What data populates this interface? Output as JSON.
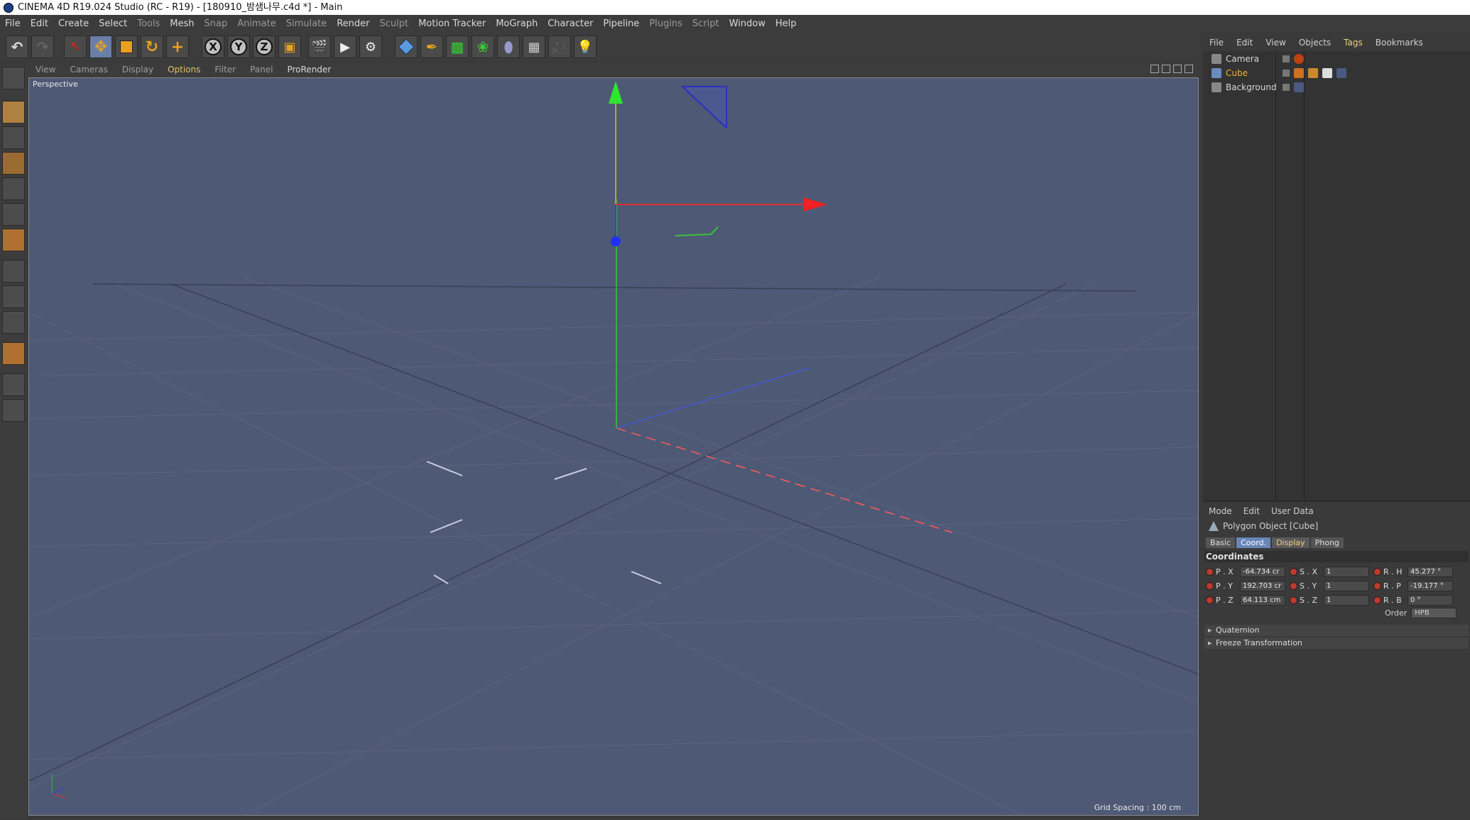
{
  "window": {
    "title": "CINEMA 4D R19.024 Studio (RC - R19) - [180910_밤샘나무.c4d *] - Main"
  },
  "menubar": {
    "items": [
      "File",
      "Edit",
      "Create",
      "Select",
      "Tools",
      "Mesh",
      "Snap",
      "Animate",
      "Simulate",
      "Render",
      "Sculpt",
      "Motion Tracker",
      "MoGraph",
      "Character",
      "Pipeline",
      "Plugins",
      "Script",
      "Window",
      "Help"
    ]
  },
  "toolbar": {
    "axis_x": "X",
    "axis_y": "Y",
    "axis_z": "Z"
  },
  "viewport": {
    "menu": [
      "View",
      "Cameras",
      "Display",
      "Options",
      "Filter",
      "Panel",
      "ProRender"
    ],
    "view_name": "Perspective",
    "grid_spacing": "Grid Spacing : 100 cm",
    "background_color": "#4e5975"
  },
  "object_manager": {
    "menu": [
      "File",
      "Edit",
      "View",
      "Objects",
      "Tags",
      "Bookmarks"
    ],
    "objects": [
      {
        "name": "Camera"
      },
      {
        "name": "Cube",
        "selected": true
      },
      {
        "name": "Background"
      }
    ]
  },
  "attributes": {
    "menu": [
      "Mode",
      "Edit",
      "User Data"
    ],
    "object_title": "Polygon Object [Cube]",
    "tabs": [
      "Basic",
      "Coord.",
      "Display",
      "Phong"
    ],
    "section": "Coordinates",
    "rows": [
      {
        "p_label": "P . X",
        "p_val": "-64.734 cr",
        "s_label": "S . X",
        "s_val": "1",
        "r_label": "R . H",
        "r_val": "45.277 °"
      },
      {
        "p_label": "P . Y",
        "p_val": "192.703 cr",
        "s_label": "S . Y",
        "s_val": "1",
        "r_label": "R . P",
        "r_val": "-19.177 °"
      },
      {
        "p_label": "P . Z",
        "p_val": "64.113 cm",
        "s_label": "S . Z",
        "s_val": "1",
        "r_label": "R . B",
        "r_val": "0 °"
      }
    ],
    "order_label": "Order",
    "order_value": "HPB",
    "folds": [
      "Quaternion",
      "Freeze Transformation"
    ]
  }
}
